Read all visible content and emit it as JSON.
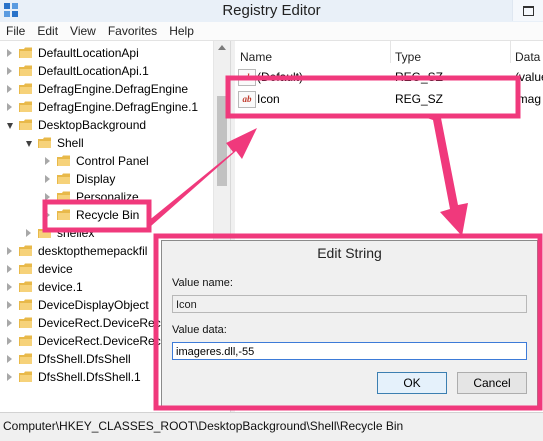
{
  "window": {
    "title": "Registry Editor"
  },
  "menu": [
    "File",
    "Edit",
    "View",
    "Favorites",
    "Help"
  ],
  "tree": {
    "items": [
      {
        "label": "DefaultLocationApi",
        "expander": "collapsed"
      },
      {
        "label": "DefaultLocationApi.1",
        "expander": "collapsed"
      },
      {
        "label": "DefragEngine.DefragEngine",
        "expander": "collapsed"
      },
      {
        "label": "DefragEngine.DefragEngine.1",
        "expander": "collapsed"
      },
      {
        "label": "DesktopBackground",
        "expander": "expanded"
      },
      {
        "label": "Shell",
        "expander": "expanded"
      },
      {
        "label": "Control Panel",
        "expander": "collapsed"
      },
      {
        "label": "Display",
        "expander": "collapsed"
      },
      {
        "label": "Personalize",
        "expander": "collapsed"
      },
      {
        "label": "Recycle Bin",
        "expander": "collapsed"
      },
      {
        "label": "shellex",
        "expander": "collapsed"
      },
      {
        "label": "desktopthemepackfil",
        "expander": "collapsed"
      },
      {
        "label": "device",
        "expander": "collapsed"
      },
      {
        "label": "device.1",
        "expander": "collapsed"
      },
      {
        "label": "DeviceDisplayObject",
        "expander": "collapsed"
      },
      {
        "label": "DeviceRect.DeviceRec",
        "expander": "collapsed"
      },
      {
        "label": "DeviceRect.DeviceRec",
        "expander": "collapsed"
      },
      {
        "label": "DfsShell.DfsShell",
        "expander": "collapsed"
      },
      {
        "label": "DfsShell.DfsShell.1",
        "expander": "collapsed"
      }
    ]
  },
  "list": {
    "columns": [
      "Name",
      "Type",
      "Data"
    ],
    "rows": [
      {
        "name": "(Default)",
        "type": "REG_SZ",
        "data": "(value"
      },
      {
        "name": "Icon",
        "type": "REG_SZ",
        "data": "imag"
      }
    ]
  },
  "dialog": {
    "title": "Edit String",
    "value_name_label": "Value name:",
    "value_name": "Icon",
    "value_data_label": "Value data:",
    "value_data": "imageres.dll,-55",
    "ok_label": "OK",
    "cancel_label": "Cancel"
  },
  "statusbar": {
    "path": "Computer\\HKEY_CLASSES_ROOT\\DesktopBackground\\Shell\\Recycle Bin"
  },
  "colors": {
    "annotation": "#f0397c",
    "folder": "#e8b94a",
    "title_bar": "#e9f0f8"
  }
}
